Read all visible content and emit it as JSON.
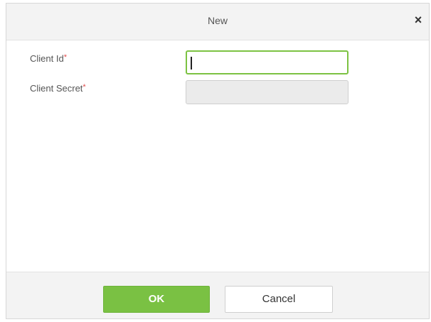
{
  "dialog": {
    "title": "New",
    "close_label": "×"
  },
  "form": {
    "client_id": {
      "label": "Client Id",
      "required_mark": "*",
      "value": ""
    },
    "client_secret": {
      "label": "Client Secret",
      "required_mark": "*",
      "value": ""
    }
  },
  "footer": {
    "ok_label": "OK",
    "cancel_label": "Cancel"
  },
  "colors": {
    "accent": "#7ac143",
    "required": "#e04a4a",
    "disabled_field": "#ebebeb"
  }
}
